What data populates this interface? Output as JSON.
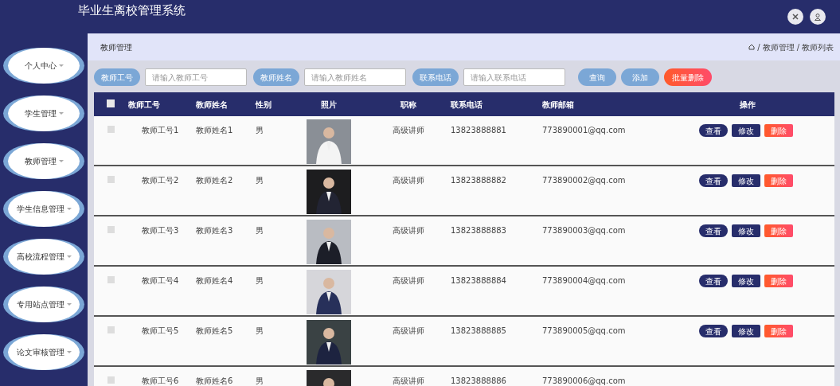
{
  "app": {
    "title": "毕业生离校管理系统"
  },
  "sidebar": {
    "items": [
      {
        "label": "个人中心"
      },
      {
        "label": "学生管理"
      },
      {
        "label": "教师管理"
      },
      {
        "label": "学生信息管理"
      },
      {
        "label": "高校流程管理"
      },
      {
        "label": "专用站点管理"
      },
      {
        "label": "论文审核管理"
      }
    ]
  },
  "page": {
    "title": "教师管理",
    "breadcrumb": [
      {
        "separator": "/",
        "label": "教师管理"
      },
      {
        "separator": "/",
        "label": "教师列表"
      }
    ]
  },
  "search": {
    "fields": [
      {
        "label": "教师工号",
        "placeholder": "请输入教师工号"
      },
      {
        "label": "教师姓名",
        "placeholder": "请输入教师姓名"
      },
      {
        "label": "联系电话",
        "placeholder": "请输入联系电话"
      }
    ],
    "buttons": [
      {
        "label": "查询",
        "kind": "query"
      },
      {
        "label": "添加",
        "kind": "add"
      },
      {
        "label": "批量删除",
        "kind": "delete"
      }
    ]
  },
  "table": {
    "select_all": {
      "checked": false
    },
    "columns": [
      "教师工号",
      "教师姓名",
      "性别",
      "照片",
      "职称",
      "联系电话",
      "教师邮箱",
      "操作"
    ],
    "rows": [
      {
        "selected": false,
        "id": "教师工号1",
        "name": "教师姓名1",
        "gender": "男",
        "title": "高级讲师",
        "phone": "13823888881",
        "email": "773890001@qq.com",
        "actions": [
          "查看",
          "修改",
          "删除"
        ]
      },
      {
        "selected": false,
        "id": "教师工号2",
        "name": "教师姓名2",
        "gender": "男",
        "title": "高级讲师",
        "phone": "13823888882",
        "email": "773890002@qq.com",
        "actions": [
          "查看",
          "修改",
          "删除"
        ]
      },
      {
        "selected": false,
        "id": "教师工号3",
        "name": "教师姓名3",
        "gender": "男",
        "title": "高级讲师",
        "phone": "13823888883",
        "email": "773890003@qq.com",
        "actions": [
          "查看",
          "修改",
          "删除"
        ]
      },
      {
        "selected": false,
        "id": "教师工号4",
        "name": "教师姓名4",
        "gender": "男",
        "title": "高级讲师",
        "phone": "13823888884",
        "email": "773890004@qq.com",
        "actions": [
          "查看",
          "修改",
          "删除"
        ]
      },
      {
        "selected": false,
        "id": "教师工号5",
        "name": "教师姓名5",
        "gender": "男",
        "title": "高级讲师",
        "phone": "13823888885",
        "email": "773890005@qq.com",
        "actions": [
          "查看",
          "修改",
          "删除"
        ]
      },
      {
        "selected": false,
        "id": "教师工号6",
        "name": "教师姓名6",
        "gender": "男",
        "title": "高级讲师",
        "phone": "13823888886",
        "email": "773890006@qq.com"
      }
    ]
  }
}
